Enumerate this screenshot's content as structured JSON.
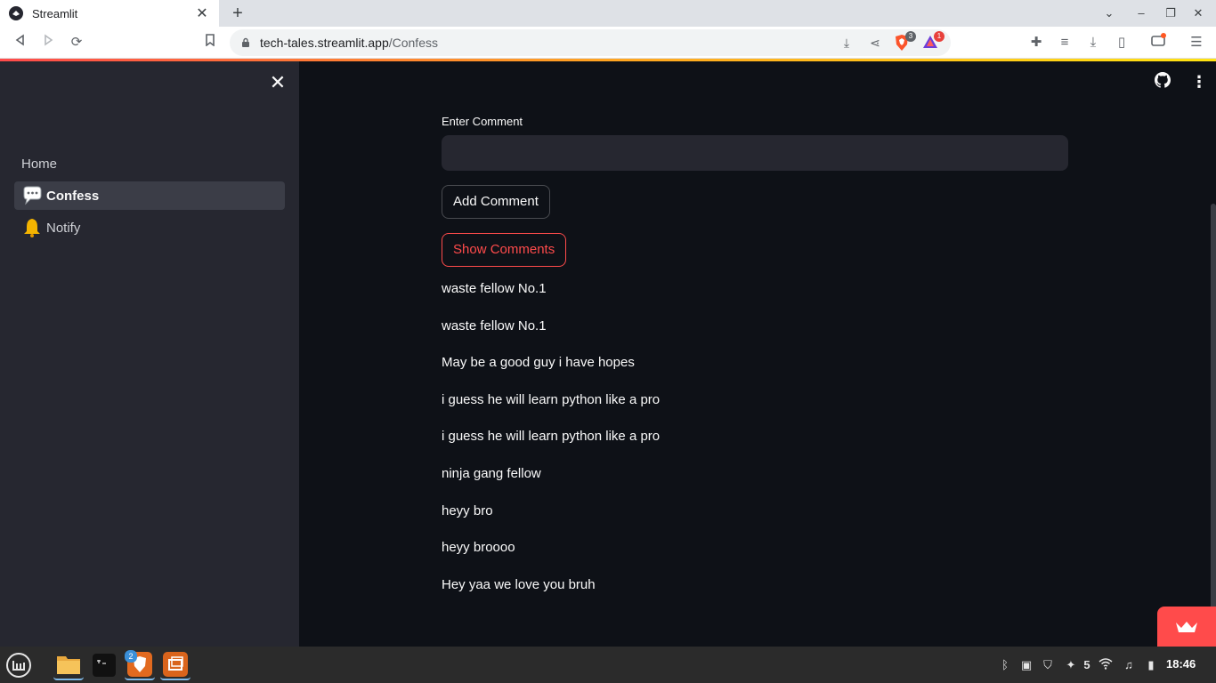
{
  "browser": {
    "tab_title": "Streamlit",
    "url_host": "tech-tales.streamlit.app",
    "url_path": "/Confess",
    "brave_shield_count": "3",
    "rewards_count": "1"
  },
  "sidebar": {
    "items": [
      {
        "label": "Home",
        "emoji": ""
      },
      {
        "label": "Confess",
        "emoji": "speech-balloon"
      },
      {
        "label": "Notify",
        "emoji": "bell"
      }
    ],
    "active": "Confess"
  },
  "main": {
    "input_label": "Enter Comment",
    "input_value": "",
    "add_button_label": "Add Comment",
    "show_button_label": "Show Comments",
    "comments": [
      "waste fellow No.1",
      "waste fellow No.1",
      "May be a good guy i have hopes",
      "i guess he will learn python like a pro",
      "i guess he will learn python like a pro",
      "ninja gang fellow",
      "heyy bro",
      "heyy broooo",
      "Hey yaa we love you bruh"
    ]
  },
  "taskbar": {
    "brave_window_count": "2",
    "tray_number": "5",
    "clock": "18:46"
  },
  "colors": {
    "primary": "#ff4b4b",
    "background": "#0e1117",
    "sidebar": "#262730",
    "text": "#fafafa"
  }
}
